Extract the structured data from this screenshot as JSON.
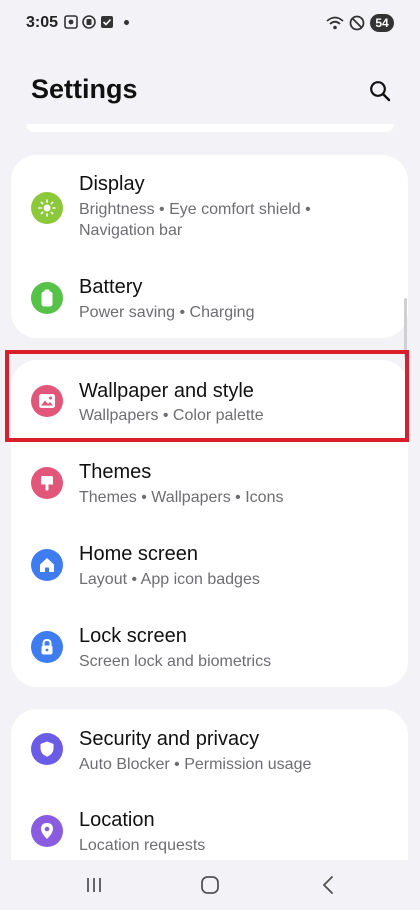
{
  "status_bar": {
    "time": "3:05",
    "battery": "54"
  },
  "header": {
    "title": "Settings"
  },
  "groups": [
    {
      "items": [
        {
          "title": "Display",
          "subtitle": "Brightness  •  Eye comfort shield  •  Navigation bar",
          "icon": "sun-icon",
          "color": "#8bc83a"
        },
        {
          "title": "Battery",
          "subtitle": "Power saving  •  Charging",
          "icon": "battery-icon",
          "color": "#56c248"
        }
      ]
    },
    {
      "items": [
        {
          "title": "Wallpaper and style",
          "subtitle": "Wallpapers  •  Color palette",
          "icon": "image-icon",
          "color": "#e2567a"
        },
        {
          "title": "Themes",
          "subtitle": "Themes  •  Wallpapers  •  Icons",
          "icon": "brush-icon",
          "color": "#e2567a"
        },
        {
          "title": "Home screen",
          "subtitle": "Layout  •  App icon badges",
          "icon": "home-icon",
          "color": "#3f7cf0"
        },
        {
          "title": "Lock screen",
          "subtitle": "Screen lock and biometrics",
          "icon": "lock-icon",
          "color": "#3f7cf0"
        }
      ]
    },
    {
      "items": [
        {
          "title": "Security and privacy",
          "subtitle": "Auto Blocker  •  Permission usage",
          "icon": "shield-icon",
          "color": "#6b5ce8"
        },
        {
          "title": "Location",
          "subtitle": "Location requests",
          "icon": "location-pin-icon",
          "color": "#8a5ce0"
        }
      ]
    }
  ],
  "highlight_color": "#d9202a"
}
